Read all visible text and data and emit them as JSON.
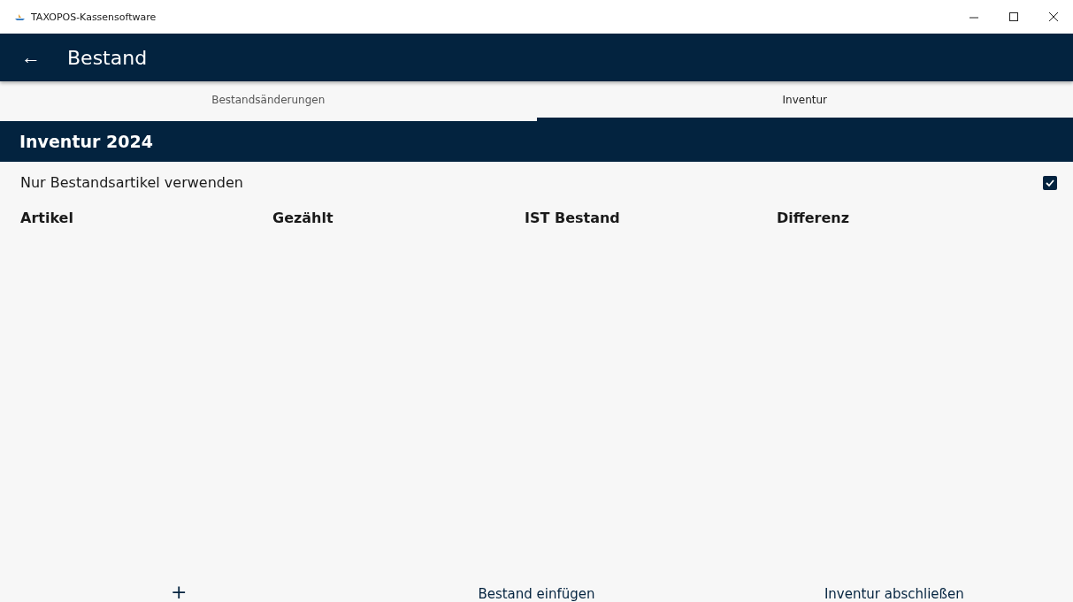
{
  "window": {
    "title": "TAXOPOS-Kassensoftware"
  },
  "header": {
    "back": "←",
    "title": "Bestand"
  },
  "tabs": [
    {
      "label": "Bestandsänderungen",
      "selected": false
    },
    {
      "label": "Inventur",
      "selected": true
    }
  ],
  "section": {
    "title": "Inventur 2024"
  },
  "option": {
    "label": "Nur Bestandsartikel verwenden",
    "checked": true
  },
  "table": {
    "columns": [
      "Artikel",
      "Gezählt",
      "IST Bestand",
      "Differenz"
    ]
  },
  "actions": [
    "+",
    "Bestand einfügen",
    "Inventur abschließen"
  ]
}
